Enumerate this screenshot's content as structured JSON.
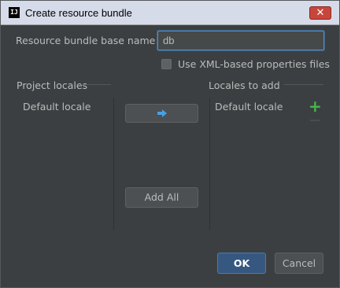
{
  "window": {
    "title": "Create resource bundle",
    "app_icon_text": "IJ"
  },
  "form": {
    "base_name_label": "Resource bundle base name:",
    "base_name_value": "db",
    "xml_checkbox_label": "Use XML-based properties files",
    "xml_checkbox_checked": false
  },
  "project_locales": {
    "title": "Project locales",
    "items": [
      "Default locale"
    ]
  },
  "locales_to_add": {
    "title": "Locales to add",
    "items": [
      "Default locale"
    ]
  },
  "buttons": {
    "add_all": "Add All",
    "ok": "OK",
    "cancel": "Cancel"
  },
  "icons": {
    "move_right": "arrow-right-icon",
    "add": "plus-icon",
    "remove": "minus-icon",
    "close": "close-icon"
  },
  "colors": {
    "background": "#3c3f41",
    "accent_blue": "#365880",
    "add_green": "#45b848",
    "close_red": "#c7463b"
  }
}
